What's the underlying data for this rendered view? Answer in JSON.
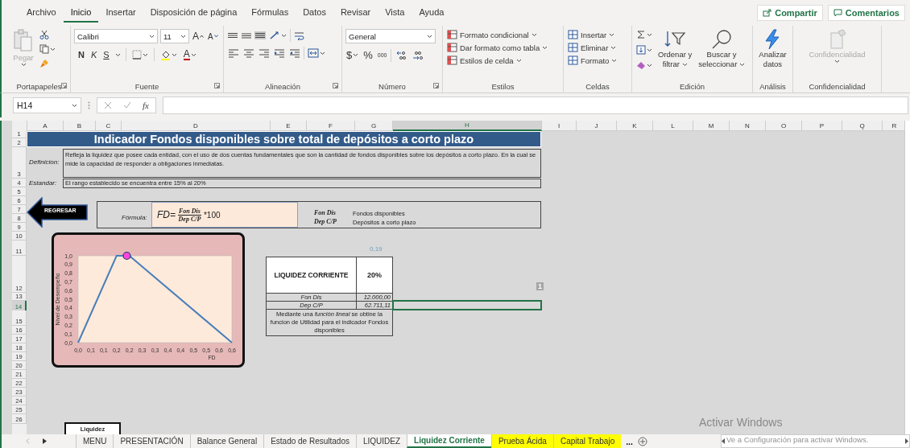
{
  "menu_tabs": [
    {
      "label": "Archivo",
      "selected": false
    },
    {
      "label": "Inicio",
      "selected": true
    },
    {
      "label": "Insertar",
      "selected": false
    },
    {
      "label": "Disposición de página",
      "selected": false
    },
    {
      "label": "Fórmulas",
      "selected": false
    },
    {
      "label": "Datos",
      "selected": false
    },
    {
      "label": "Revisar",
      "selected": false
    },
    {
      "label": "Vista",
      "selected": false
    },
    {
      "label": "Ayuda",
      "selected": false
    }
  ],
  "share_button": "Compartir",
  "comments_button": "Comentarios",
  "clipboard": {
    "paste": "Pegar",
    "label": "Portapapeles"
  },
  "font": {
    "family": "Calibri",
    "size": "11",
    "grow": "A",
    "shrink": "A",
    "bold": "N",
    "italic": "K",
    "underline": "S",
    "font_color": "A",
    "label": "Fuente"
  },
  "alignment": {
    "vertical": [
      {
        "selected": false
      },
      {
        "selected": false
      },
      {
        "selected": true
      }
    ],
    "label": "Alineación"
  },
  "number": {
    "format": "General",
    "currency": "$",
    "percent": "%",
    "thousands": "000",
    "label": "Número"
  },
  "styles": {
    "items": [
      "Formato condicional",
      "Dar formato como tabla",
      "Estilos de celda"
    ],
    "label": "Estilos"
  },
  "cells": {
    "items": [
      "Insertar",
      "Eliminar",
      "Formato"
    ],
    "label": "Celdas"
  },
  "editing": {
    "sort": [
      "Ordenar y",
      "filtrar"
    ],
    "find": [
      "Buscar y",
      "seleccionar"
    ],
    "label": "Edición"
  },
  "analysis": {
    "button": [
      "Analizar",
      "datos"
    ],
    "label": "Análisis"
  },
  "sensitivity": {
    "button": "Confidencialidad",
    "disabled": true,
    "label": "Confidencialidad"
  },
  "formula_bar": {
    "name_box": "H14",
    "fx": "fx"
  },
  "sheet": {
    "columns": [
      {
        "label": "A",
        "selected": false
      },
      {
        "label": "B",
        "selected": false
      },
      {
        "label": "C",
        "selected": false
      },
      {
        "label": "D",
        "selected": false
      },
      {
        "label": "E",
        "selected": false
      },
      {
        "label": "F",
        "selected": false
      },
      {
        "label": "G",
        "selected": false
      },
      {
        "label": "H",
        "selected": true
      },
      {
        "label": "I",
        "selected": false
      },
      {
        "label": "J",
        "selected": false
      },
      {
        "label": "K",
        "selected": false
      },
      {
        "label": "L",
        "selected": false
      },
      {
        "label": "M",
        "selected": false
      },
      {
        "label": "N",
        "selected": false
      },
      {
        "label": "O",
        "selected": false
      },
      {
        "label": "P",
        "selected": false
      },
      {
        "label": "Q",
        "selected": false
      },
      {
        "label": "R",
        "selected": false
      }
    ],
    "rows": [
      {
        "label": "1",
        "selected": false
      },
      {
        "label": "2",
        "selected": false
      },
      {
        "label": "3",
        "selected": false
      },
      {
        "label": "4",
        "selected": false
      },
      {
        "label": "5",
        "selected": false
      },
      {
        "label": "6",
        "selected": false
      },
      {
        "label": "7",
        "selected": false
      },
      {
        "label": "8",
        "selected": false
      },
      {
        "label": "9",
        "selected": false
      },
      {
        "label": "10",
        "selected": false
      },
      {
        "label": "11",
        "selected": false
      },
      {
        "label": "12",
        "selected": false
      },
      {
        "label": "13",
        "selected": false
      },
      {
        "label": "14",
        "selected": true
      },
      {
        "label": "15",
        "selected": false
      },
      {
        "label": "16",
        "selected": false
      },
      {
        "label": "17",
        "selected": false
      },
      {
        "label": "18",
        "selected": false
      },
      {
        "label": "19",
        "selected": false
      },
      {
        "label": "20",
        "selected": false
      },
      {
        "label": "21",
        "selected": false
      },
      {
        "label": "22",
        "selected": false
      },
      {
        "label": "23",
        "selected": false
      },
      {
        "label": "24",
        "selected": false
      },
      {
        "label": "25",
        "selected": false
      },
      {
        "label": "26",
        "selected": false
      }
    ],
    "title": "Indicador Fondos disponibles sobre total de depósitos a corto plazo",
    "definition_label": "Definicion:",
    "definition": "Refleja la liquidez que posee cada entidad, con el uso de dos cuentas fundamentales que son la cantidad de fondos disponibles sobre los depósitos a corto plazo. En la cual se mide la capacidad de responder a obligaciones inmediatas.",
    "standard_label": "Estandar:",
    "standard": "El rango establecido se encuentra entre 15% al 20%",
    "back_button": "REGRESAR",
    "formula": {
      "label": "Fórmula:",
      "lhs": "FD=",
      "numerator": "Fon Dis",
      "denominator": "Dep C/P",
      "factor": "*100",
      "legend": [
        {
          "term": "Fon Dis",
          "meaning": "Fondos disponibles"
        },
        {
          "term": "Dep C/P",
          "meaning": "Depósitos a corto plazo"
        }
      ]
    },
    "chart": {
      "chart_data": {
        "type": "line",
        "xlabel": "FD",
        "ylabel": "Nivel de Desempeño",
        "x": [
          0,
          0.15,
          0.19,
          0.2,
          0.6
        ],
        "series": [
          {
            "color": "#4a7ebb",
            "values": [
              0,
              1,
              1,
              1,
              0
            ]
          },
          {
            "color": "#ff44dd",
            "marker": "circle",
            "values": [
              null,
              null,
              1,
              null,
              null
            ]
          }
        ],
        "xlim": [
          0,
          0.6
        ],
        "ylim": [
          0,
          1
        ],
        "xticks": [
          {
            "value": 0,
            "label": "0,0"
          },
          {
            "value": 0.05,
            "label": "0,1"
          },
          {
            "value": 0.1,
            "label": "0,1"
          },
          {
            "value": 0.15,
            "label": "0,2"
          },
          {
            "value": 0.2,
            "label": "0,2"
          },
          {
            "value": 0.25,
            "label": "0,3"
          },
          {
            "value": 0.3,
            "label": "0,3"
          },
          {
            "value": 0.35,
            "label": "0,4"
          },
          {
            "value": 0.4,
            "label": "0,4"
          },
          {
            "value": 0.45,
            "label": "0,5"
          },
          {
            "value": 0.5,
            "label": "0,5"
          },
          {
            "value": 0.55,
            "label": "0,6"
          },
          {
            "value": 0.6,
            "label": "0,6"
          }
        ],
        "yticks": [
          {
            "value": 0,
            "label": "0,0"
          },
          {
            "value": 0.1,
            "label": "0,1"
          },
          {
            "value": 0.2,
            "label": "0,2"
          },
          {
            "value": 0.3,
            "label": "0,3"
          },
          {
            "value": 0.4,
            "label": "0,4"
          },
          {
            "value": 0.5,
            "label": "0,5"
          },
          {
            "value": 0.6,
            "label": "0,6"
          },
          {
            "value": 0.7,
            "label": "0,7"
          },
          {
            "value": 0.8,
            "label": "0,8"
          },
          {
            "value": 0.9,
            "label": "0,9"
          },
          {
            "value": 1,
            "label": "1,0"
          }
        ]
      }
    },
    "result_table": {
      "title": "LIQUIDEZ CORRIENTE",
      "value": "20%",
      "rows": [
        {
          "label": "Fon Dis",
          "value": "12.000,00"
        },
        {
          "label": "Dep C/P",
          "value": "62.711,11"
        }
      ],
      "note": "Mediante una *función lineal* se obtine la funcion de Utilidad para el indicador Fondos disponibles"
    },
    "faint_value": "0,19",
    "white_value": "1",
    "cut_shape": "Liquidez"
  },
  "sheet_tabs": [
    {
      "label": "MENU",
      "selected": false
    },
    {
      "label": "PRESENTACIÓN",
      "selected": false
    },
    {
      "label": "Balance General",
      "selected": false
    },
    {
      "label": "Estado de Resultados",
      "selected": false
    },
    {
      "label": "LIQUIDEZ",
      "selected": false
    },
    {
      "label": "Liquidez Corriente",
      "selected": true
    },
    {
      "label": "Prueba Ácida",
      "selected": false,
      "color": "#ffff00"
    },
    {
      "label": "Capital Trabajo",
      "selected": false,
      "color": "#ffff00"
    }
  ],
  "more_tabs": "...",
  "activation": {
    "title": "Activar Windows",
    "message": "Ve a Configuración para activar Windows."
  }
}
